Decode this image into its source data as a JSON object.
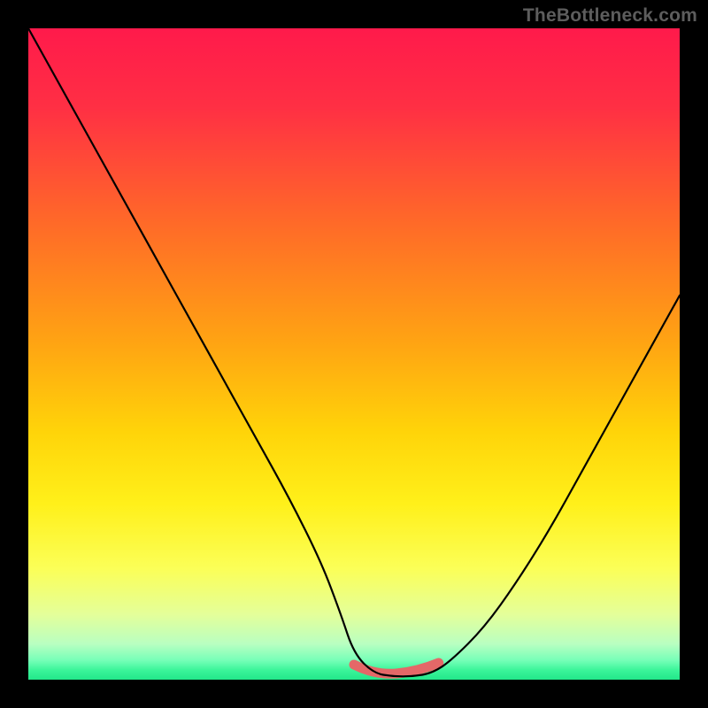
{
  "watermark": "TheBottleneck.com",
  "colors": {
    "frame": "#000000",
    "curve": "#000000",
    "bump": "#e46868",
    "gradient_stops": [
      {
        "offset": 0.0,
        "color": "#ff1a4b"
      },
      {
        "offset": 0.12,
        "color": "#ff2f44"
      },
      {
        "offset": 0.3,
        "color": "#ff6a28"
      },
      {
        "offset": 0.48,
        "color": "#ffa313"
      },
      {
        "offset": 0.62,
        "color": "#ffd409"
      },
      {
        "offset": 0.73,
        "color": "#fff01a"
      },
      {
        "offset": 0.83,
        "color": "#fbff58"
      },
      {
        "offset": 0.9,
        "color": "#e4ff9a"
      },
      {
        "offset": 0.945,
        "color": "#b9ffc1"
      },
      {
        "offset": 0.97,
        "color": "#77ffb8"
      },
      {
        "offset": 0.985,
        "color": "#3cf59a"
      },
      {
        "offset": 1.0,
        "color": "#22e78a"
      }
    ]
  },
  "chart_data": {
    "type": "line",
    "title": "",
    "xlabel": "",
    "ylabel": "",
    "xlim": [
      0,
      100
    ],
    "ylim": [
      0,
      100
    ],
    "series": [
      {
        "name": "bottleneck-curve",
        "x": [
          0,
          5,
          10,
          15,
          20,
          25,
          30,
          35,
          40,
          45,
          48,
          50,
          53,
          56,
          59,
          62,
          65,
          70,
          75,
          80,
          85,
          90,
          95,
          100
        ],
        "y": [
          100,
          91,
          82,
          73,
          64,
          55,
          46,
          37,
          28,
          18,
          10,
          4,
          1,
          0.5,
          0.5,
          1,
          3,
          8,
          15,
          23,
          32,
          41,
          50,
          59
        ]
      }
    ],
    "annotations": [
      {
        "name": "valley-bump",
        "x_range": [
          50,
          63
        ],
        "y": 1.5
      }
    ]
  }
}
